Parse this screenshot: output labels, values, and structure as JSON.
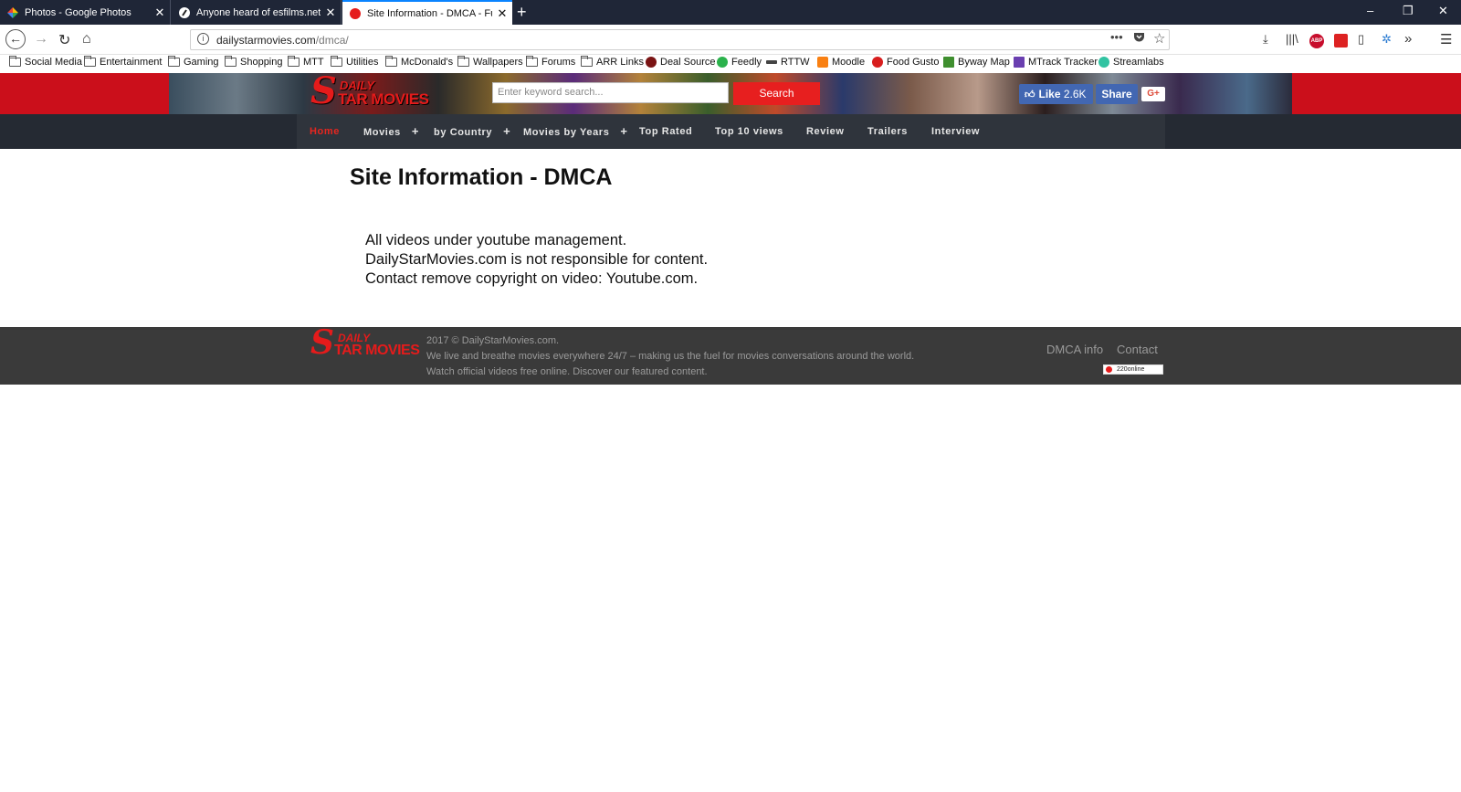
{
  "browser": {
    "tabs": [
      {
        "title": "Photos - Google Photos",
        "favicon_color": "#f4b400"
      },
      {
        "title": "Anyone heard of esfilms.net? |",
        "favicon_color": "#222222"
      },
      {
        "title": "Site Information - DMCA - Full",
        "favicon_color": "#e51b1b"
      }
    ],
    "new_tab_symbol": "+",
    "window_controls": {
      "minimize": "–",
      "restore": "❐",
      "close": "✕"
    },
    "url_host": "dailystarmovies.com",
    "url_path": "/dmca/",
    "bookmarks": [
      {
        "label": "Social Media",
        "type": "folder"
      },
      {
        "label": "Entertainment",
        "type": "folder"
      },
      {
        "label": "Gaming",
        "type": "folder"
      },
      {
        "label": "Shopping",
        "type": "folder"
      },
      {
        "label": "MTT",
        "type": "folder"
      },
      {
        "label": "Utilities",
        "type": "folder"
      },
      {
        "label": "McDonald's",
        "type": "folder"
      },
      {
        "label": "Wallpapers",
        "type": "folder"
      },
      {
        "label": "Forums",
        "type": "folder"
      },
      {
        "label": "ARR Links",
        "type": "folder"
      },
      {
        "label": "Deal Source",
        "type": "site",
        "color": "#7a1414"
      },
      {
        "label": "Feedly",
        "type": "site",
        "color": "#2bb24c"
      },
      {
        "label": "RTTW",
        "type": "site",
        "color": "#444444"
      },
      {
        "label": "Moodle",
        "type": "site",
        "color": "#f98012"
      },
      {
        "label": "Food Gusto",
        "type": "site",
        "color": "#d81e1e"
      },
      {
        "label": "Byway Map",
        "type": "site",
        "color": "#3f8f2f"
      },
      {
        "label": "MTrack Tracker",
        "type": "site",
        "color": "#6a3fb0"
      },
      {
        "label": "Streamlabs",
        "type": "site",
        "color": "#31c3a2"
      }
    ],
    "abp_label": "ABP"
  },
  "site": {
    "logo": {
      "letter": "S",
      "line1": "DAILY",
      "line2": "TAR MOVIES"
    },
    "search_placeholder": "Enter keyword search...",
    "search_button": "Search",
    "fb_like": "Like",
    "fb_like_count": "2.6K",
    "fb_share": "Share",
    "gplus": "G+",
    "menu": [
      {
        "label": "Home",
        "active": true,
        "has_sub": false
      },
      {
        "label": "Movies",
        "active": false,
        "has_sub": true
      },
      {
        "label": "by Country",
        "active": false,
        "has_sub": true
      },
      {
        "label": "Movies by Years",
        "active": false,
        "has_sub": true
      },
      {
        "label": "Top Rated",
        "active": false,
        "has_sub": false
      },
      {
        "label": "Top 10 views",
        "active": false,
        "has_sub": false
      },
      {
        "label": "Review",
        "active": false,
        "has_sub": false
      },
      {
        "label": "Trailers",
        "active": false,
        "has_sub": false
      },
      {
        "label": "Interview",
        "active": false,
        "has_sub": false
      }
    ],
    "page_title": "Site Information - DMCA",
    "body_lines": [
      "All videos under youtube management.",
      "DailyStarMovies.com is not responsible for content.",
      "Contact remove copyright on video: Youtube.com."
    ],
    "footer": {
      "copyright": "2017 © DailyStarMovies.com.",
      "tagline1": "We live and breathe movies everywhere 24/7 – making us the fuel for movies conversations around the world.",
      "tagline2": "Watch official videos free online. Discover our featured content.",
      "link_dmca": "DMCA info",
      "link_contact": "Contact",
      "online_count": "220",
      "online_label": "online"
    },
    "colors": {
      "brand_red": "#cb0f1b",
      "menu_bg": "#2f343c",
      "footer_bg": "#3a3a3a",
      "fb_blue": "#4267b2"
    }
  }
}
